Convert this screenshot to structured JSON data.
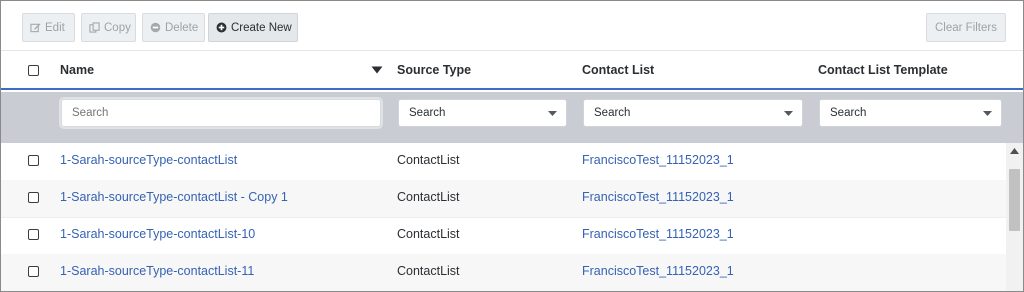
{
  "toolbar": {
    "edit_label": "Edit",
    "copy_label": "Copy",
    "delete_label": "Delete",
    "create_label": "Create New",
    "clear_filters_label": "Clear Filters"
  },
  "columns": {
    "name": "Name",
    "source_type": "Source Type",
    "contact_list": "Contact List",
    "contact_list_template": "Contact List Template"
  },
  "filters": {
    "name_placeholder": "Search",
    "source_type_value": "Search",
    "contact_list_value": "Search",
    "template_value": "Search"
  },
  "rows": [
    {
      "name": "1-Sarah-sourceType-contactList",
      "source_type": "ContactList",
      "contact_list": "FranciscoTest_11152023_1",
      "template": ""
    },
    {
      "name": "1-Sarah-sourceType-contactList - Copy 1",
      "source_type": "ContactList",
      "contact_list": "FranciscoTest_11152023_1",
      "template": ""
    },
    {
      "name": "1-Sarah-sourceType-contactList-10",
      "source_type": "ContactList",
      "contact_list": "FranciscoTest_11152023_1",
      "template": ""
    },
    {
      "name": "1-Sarah-sourceType-contactList-11",
      "source_type": "ContactList",
      "contact_list": "FranciscoTest_11152023_1",
      "template": ""
    }
  ],
  "colors": {
    "link": "#3562b3",
    "header_underline": "#3b6fc5",
    "filter_bar": "#c9cdd3"
  }
}
